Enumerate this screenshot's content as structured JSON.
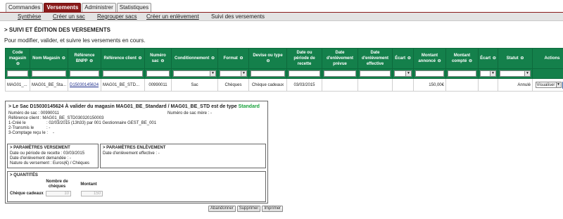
{
  "tabs": [
    "Commandes",
    "Versements",
    "Administrer",
    "Statistiques"
  ],
  "subnav": {
    "items": [
      "Synthèse",
      "Créer un sac",
      "Regrouper sacs",
      "Créer un enlèvement"
    ],
    "current": "Suivi des versements"
  },
  "page": {
    "title": "> SUIVI ET ÉDITION DES VERSEMENTS",
    "description": "Pour modifier, valider, et suivre les versements en cours."
  },
  "table": {
    "headers": [
      "Code magasin",
      "Nom Magasin",
      "Référence BNPP",
      "Référence client",
      "Numéro sac",
      "Conditionnement",
      "Format",
      "Devise ou type",
      "Date ou période de recette",
      "Date d'enlèvement prévue",
      "Date d'enlèvement effective",
      "Écart",
      "Montant annoncé",
      "Montant compté",
      "Écart",
      "Statut",
      "Actions"
    ],
    "sort_glyph": "⊖",
    "rows": [
      {
        "code": "MAG01_...",
        "nom": "MAG01_BE_Sta...",
        "ref_bnpp": "D15030145624",
        "ref_client": "MAG01_BE_STD...",
        "numero_sac": "00990011",
        "conditionnement": "Sac",
        "format": "Chèques",
        "devise": "Chèque cadeaux",
        "date_recette": "03/03/2015",
        "date_prevue": "",
        "date_effective": "",
        "ecart1": "",
        "montant_annonce": "150,00€",
        "montant_compte": "",
        "ecart2": "",
        "statut": "Annulé",
        "action_select": "Visualiser"
      }
    ]
  },
  "detail": {
    "title_prefix": "> Le Sac D15030145624 À valider du magasin MAG01_BE_Standard / MAG01_BE_STD est de type",
    "title_type": "Standard",
    "numero_sac": "Numéro de sac : 00990011",
    "numero_sac_mere": "Numéro de sac mère : -",
    "ref_client": "Référence client : MAG01_BE_STD030320150003",
    "cree_le_label": "1-Créé le",
    "cree_le_value": ": 02/03/2015 (13h33) par 001 Gestionnaire GEST_BE_001",
    "transmis_label": "2-Transmis le",
    "transmis_value": ": -",
    "comptage_label": "3-Comptage reçu le :",
    "comptage_value": "-",
    "param_versement": {
      "title": "> PARAMÈTRES VERSEMENT",
      "lines": [
        "Date ou période de recette : 03/03/2015",
        "Date d'enlèvement demandée : -",
        "Nature du versement : Euros(€) / Chèques"
      ]
    },
    "param_enlevement": {
      "title": "> PARAMÈTRES ENLÈVEMENT",
      "lines": [
        "Date d'enlèvement effective : -"
      ]
    },
    "quantites": {
      "title": "> QUANTITÉS",
      "col1": "Nombre de chèques",
      "col2": "Montant",
      "row_label": "Chèque cadeaux",
      "nb": "10",
      "montant": "150"
    }
  },
  "buttons": [
    "Abandonner",
    "Supprimer",
    "Imprimer"
  ],
  "colors": {
    "tab_active": "#8a1a1a",
    "header_green": "#14804b",
    "standard_green": "#17a03a"
  }
}
